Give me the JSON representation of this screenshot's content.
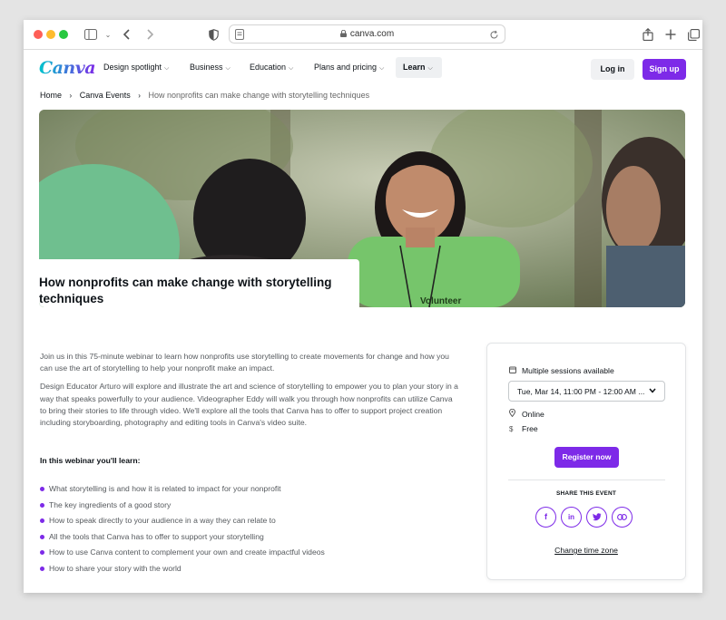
{
  "browser": {
    "url": "canva.com"
  },
  "nav": {
    "logo": "Canva",
    "items": [
      {
        "label": "Design spotlight"
      },
      {
        "label": "Business"
      },
      {
        "label": "Education"
      },
      {
        "label": "Plans and pricing"
      }
    ],
    "learn_label": "Learn",
    "login_label": "Log in",
    "signup_label": "Sign up"
  },
  "breadcrumb": {
    "home": "Home",
    "events": "Canva Events",
    "current": "How nonprofits can make change with storytelling techniques"
  },
  "hero": {
    "title": "How nonprofits can make change with storytelling techniques",
    "shirt_text": "Volunteer"
  },
  "description": {
    "paragraph1": "Join us in this 75-minute webinar to learn how nonprofits use storytelling to create movements for change and how you can use the art of storytelling to help your nonprofit make an impact.",
    "paragraph2": "Design Educator Arturo will explore and illustrate the art and science of storytelling to empower you to plan your story in a way that speaks powerfully to your audience. Videographer Eddy will walk you through how nonprofits can utilize Canva to bring their stories to life through video. We'll explore all the tools that Canva has to offer to support project creation including storyboarding, photography and editing tools in Canva's video suite.",
    "learn_title": "In this webinar you'll learn:",
    "bullets": [
      "What storytelling is and how it is related to impact for your nonprofit",
      "The key ingredients of a good story",
      "How to speak directly to your audience in a way they can relate to",
      "All the tools that Canva has to offer to support your storytelling",
      "How to use Canva content to complement your own and create impactful videos",
      "How to share your story with the world"
    ]
  },
  "event": {
    "sessions_label": "Multiple sessions available",
    "selected_session": "Tue, Mar 14, 11:00 PM - 12:00 AM ...",
    "location": "Online",
    "price": "Free",
    "register_label": "Register now",
    "share_title": "SHARE THIS EVENT",
    "share_icons": [
      "facebook-icon",
      "linkedin-icon",
      "twitter-icon",
      "link-icon"
    ],
    "timezone_link": "Change time zone"
  },
  "colors": {
    "brand": "#7d2ae8",
    "logo_gradient_start": "#00c4cc",
    "text": "#0e1318",
    "muted": "#55595d"
  }
}
